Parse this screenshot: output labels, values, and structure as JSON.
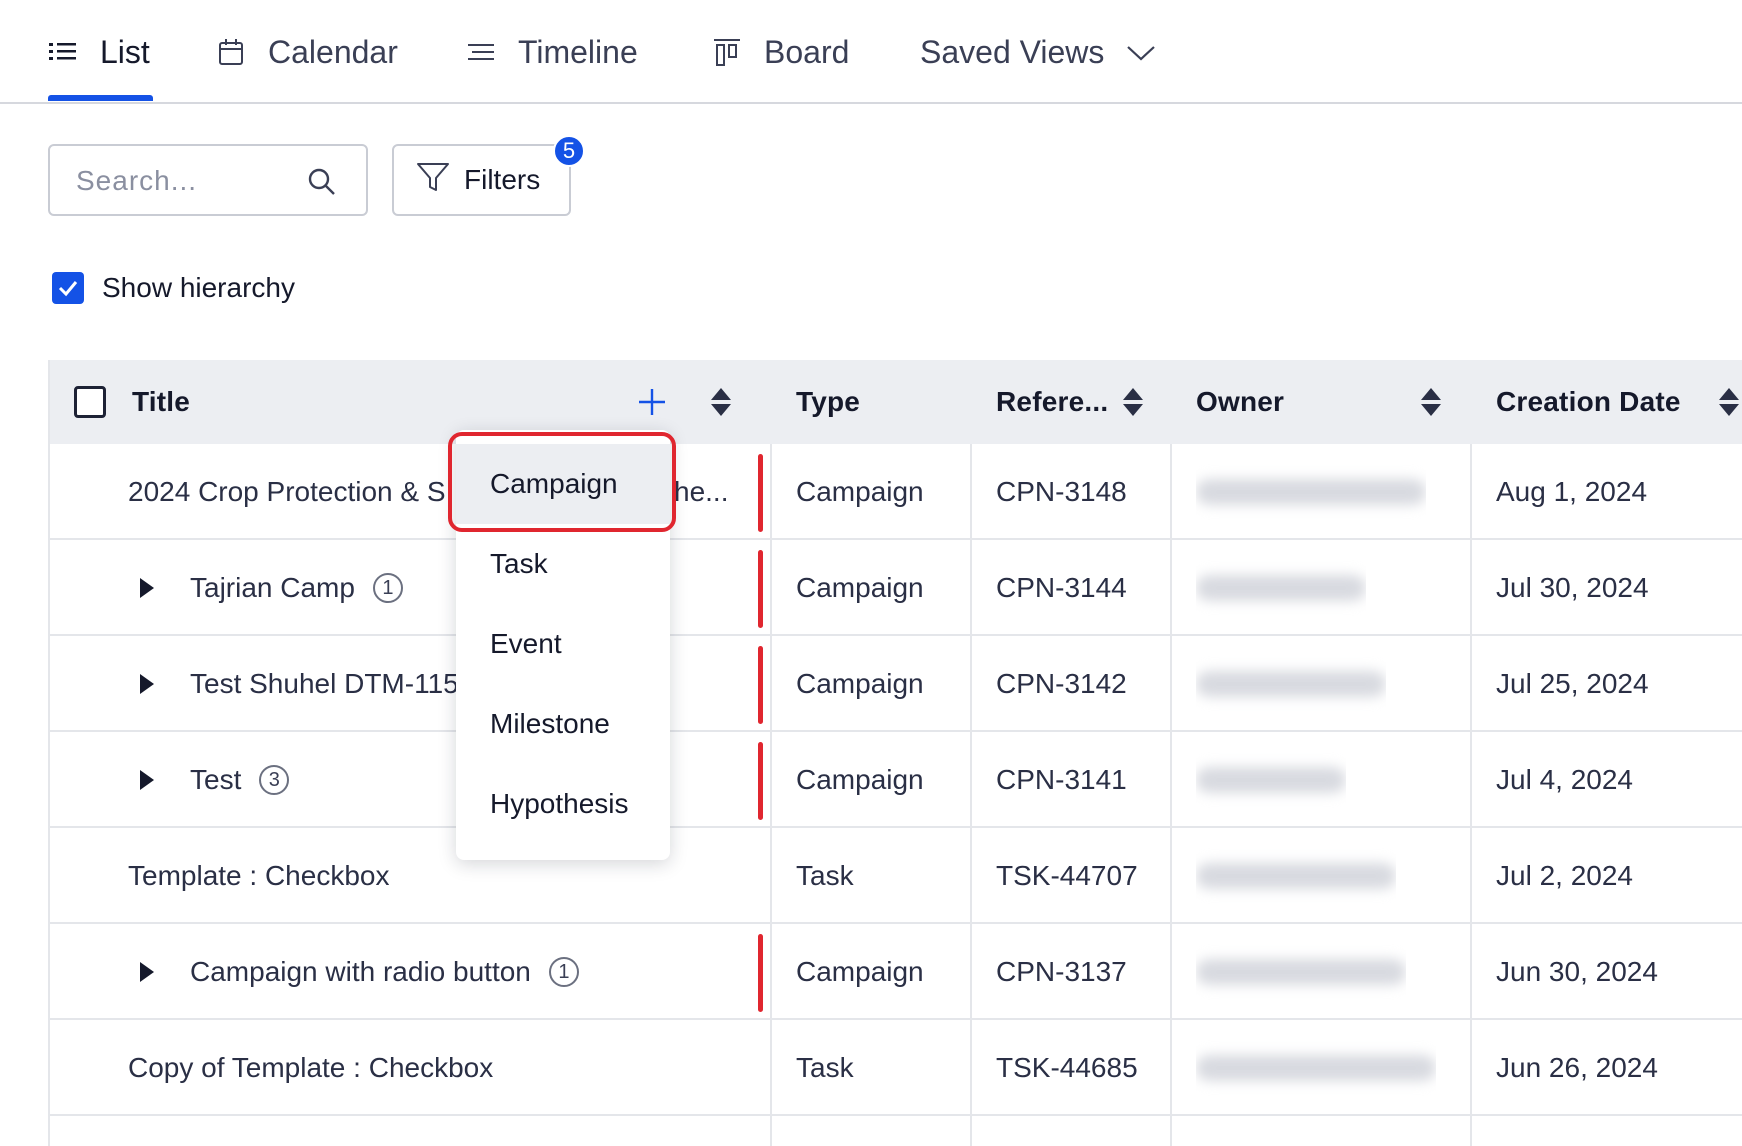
{
  "tabs": [
    {
      "label": "List",
      "icon": "list-icon",
      "active": true
    },
    {
      "label": "Calendar",
      "icon": "calendar-icon"
    },
    {
      "label": "Timeline",
      "icon": "timeline-icon"
    },
    {
      "label": "Board",
      "icon": "board-icon"
    },
    {
      "label": "Saved Views",
      "icon": "chevron-down-icon"
    }
  ],
  "toolbar": {
    "search_placeholder": "Search...",
    "filters_label": "Filters",
    "filters_count": "5",
    "hierarchy_label": "Show hierarchy",
    "hierarchy_checked": true
  },
  "table": {
    "columns": [
      "Title",
      "Type",
      "Refere...",
      "Owner",
      "Creation Date"
    ],
    "rows": [
      {
        "title": "2024 Crop Protection & S",
        "title_tail": "he...",
        "type": "Campaign",
        "ref": "CPN-3148",
        "date": "Aug 1, 2024"
      },
      {
        "title": "Tajrian Camp",
        "count": "1",
        "type": "Campaign",
        "ref": "CPN-3144",
        "date": "Jul 30, 2024"
      },
      {
        "title": "Test Shuhel DTM-115",
        "type": "Campaign",
        "ref": "CPN-3142",
        "date": "Jul 25, 2024"
      },
      {
        "title": "Test",
        "count": "3",
        "type": "Campaign",
        "ref": "CPN-3141",
        "date": "Jul 4, 2024"
      },
      {
        "title": "Template : Checkbox",
        "type": "Task",
        "ref": "TSK-44707",
        "date": "Jul 2, 2024"
      },
      {
        "title": "Campaign with radio button",
        "count": "1",
        "type": "Campaign",
        "ref": "CPN-3137",
        "date": "Jun 30, 2024"
      },
      {
        "title": "Copy of Template : Checkbox",
        "type": "Task",
        "ref": "TSK-44685",
        "date": "Jun 26, 2024"
      }
    ]
  },
  "add_menu": {
    "items": [
      "Campaign",
      "Task",
      "Event",
      "Milestone",
      "Hypothesis"
    ],
    "selected": "Campaign"
  },
  "colors": {
    "accent": "#1452e6",
    "highlight": "#e0262f",
    "header_bg": "#eceef2"
  }
}
